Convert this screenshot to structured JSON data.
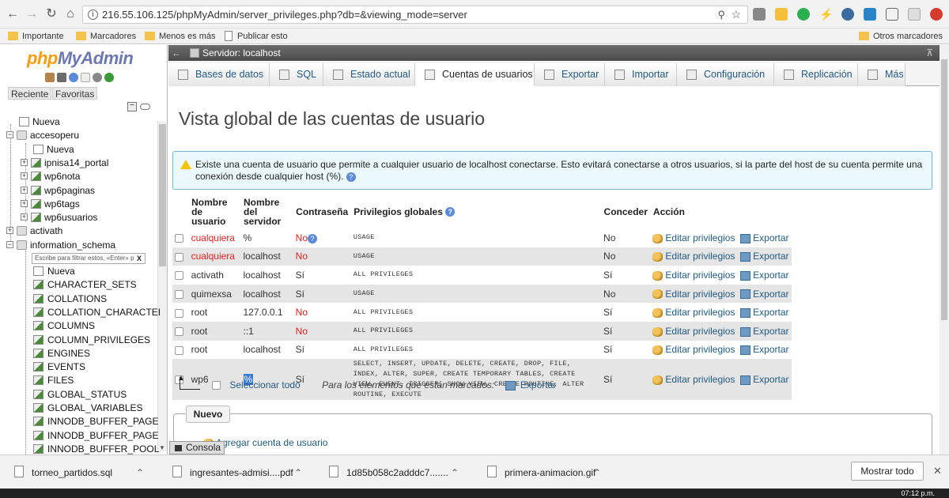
{
  "browser": {
    "url": "216.55.106.125/phpMyAdmin/server_privileges.php?db=&viewing_mode=server",
    "bookmarks": [
      "Importante",
      "Marcadores",
      "Menos es más",
      "Publicar esto"
    ],
    "other_bookmarks": "Otros marcadores"
  },
  "sidebar": {
    "logo_php": "php",
    "logo_myadmin": "MyAdmin",
    "tabs": [
      "Reciente",
      "Favoritas"
    ],
    "filter_placeholder": "Escribe para filtrar estos, «Enter» p",
    "filter_clear": "X",
    "tree": [
      {
        "label": "Nueva",
        "level": 0,
        "type": "new"
      },
      {
        "label": "accesoperu",
        "level": 0,
        "type": "db",
        "expander": "−"
      },
      {
        "label": "Nueva",
        "level": 1,
        "type": "new"
      },
      {
        "label": "ipnisa14_portal",
        "level": 1,
        "type": "table",
        "expander": "+"
      },
      {
        "label": "wp6nota",
        "level": 1,
        "type": "table",
        "expander": "+"
      },
      {
        "label": "wp6paginas",
        "level": 1,
        "type": "table",
        "expander": "+"
      },
      {
        "label": "wp6tags",
        "level": 1,
        "type": "table",
        "expander": "+"
      },
      {
        "label": "wp6usuarios",
        "level": 1,
        "type": "table",
        "expander": "+"
      },
      {
        "label": "activath",
        "level": 0,
        "type": "db",
        "expander": "+"
      },
      {
        "label": "information_schema",
        "level": 0,
        "type": "db",
        "expander": "−"
      }
    ],
    "schema_tables": [
      {
        "label": "Nueva",
        "type": "new"
      },
      {
        "label": "CHARACTER_SETS",
        "type": "table"
      },
      {
        "label": "COLLATIONS",
        "type": "table"
      },
      {
        "label": "COLLATION_CHARACTEI",
        "type": "table"
      },
      {
        "label": "COLUMNS",
        "type": "table"
      },
      {
        "label": "COLUMN_PRIVILEGES",
        "type": "table"
      },
      {
        "label": "ENGINES",
        "type": "table"
      },
      {
        "label": "EVENTS",
        "type": "table"
      },
      {
        "label": "FILES",
        "type": "table"
      },
      {
        "label": "GLOBAL_STATUS",
        "type": "table"
      },
      {
        "label": "GLOBAL_VARIABLES",
        "type": "table"
      },
      {
        "label": "INNODB_BUFFER_PAGE",
        "type": "table"
      },
      {
        "label": "INNODB_BUFFER_PAGE",
        "type": "table"
      },
      {
        "label": "INNODB_BUFFER_POOL",
        "type": "table"
      }
    ]
  },
  "server_bar": {
    "label": "Servidor: localhost"
  },
  "tabs": [
    {
      "label": "Bases de datos",
      "active": false
    },
    {
      "label": "SQL",
      "active": false
    },
    {
      "label": "Estado actual",
      "active": false
    },
    {
      "label": "Cuentas de usuarios",
      "active": true
    },
    {
      "label": "Exportar",
      "active": false
    },
    {
      "label": "Importar",
      "active": false
    },
    {
      "label": "Configuración",
      "active": false
    },
    {
      "label": "Replicación",
      "active": false
    },
    {
      "label": "Más",
      "active": false
    }
  ],
  "page_title": "Vista global de las cuentas de usuario",
  "notice": "Existe una cuenta de usuario que permite a cualquier usuario de localhost conectarse. Esto evitará conectarse a otros usuarios, si la parte del host de su cuenta permite una conexión desde cualquier host (%).",
  "table": {
    "headers": {
      "user": "Nombre de usuario",
      "host": "Nombre del servidor",
      "password": "Contraseña",
      "privileges": "Privilegios globales",
      "grant": "Conceder",
      "action": "Acción"
    },
    "edit_label": "Editar privilegios",
    "export_label": "Exportar",
    "rows": [
      {
        "user": "cualquiera",
        "user_red": true,
        "host": "%",
        "password": "No",
        "password_red": true,
        "password_help": true,
        "privileges": "USAGE",
        "grant": "No"
      },
      {
        "user": "cualquiera",
        "user_red": true,
        "host": "localhost",
        "password": "No",
        "password_red": true,
        "privileges": "USAGE",
        "grant": "No"
      },
      {
        "user": "activath",
        "host": "localhost",
        "password": "Sí",
        "privileges": "ALL PRIVILEGES",
        "grant": "Sí"
      },
      {
        "user": "quimexsa",
        "host": "localhost",
        "password": "Sí",
        "privileges": "USAGE",
        "grant": "No"
      },
      {
        "user": "root",
        "host": "127.0.0.1",
        "password": "No",
        "password_red": true,
        "privileges": "ALL PRIVILEGES",
        "grant": "Sí"
      },
      {
        "user": "root",
        "host": "::1",
        "password": "No",
        "password_red": true,
        "privileges": "ALL PRIVILEGES",
        "grant": "Sí"
      },
      {
        "user": "root",
        "host": "localhost",
        "password": "Sí",
        "privileges": "ALL PRIVILEGES",
        "grant": "Sí"
      },
      {
        "user": "wp6",
        "host": "%",
        "host_selected": true,
        "password": "Sí",
        "privileges": "SELECT, INSERT, UPDATE, DELETE, CREATE, DROP, FILE, INDEX, ALTER, SUPER, CREATE TEMPORARY TABLES, CREATE VIEW, EVENT, TRIGGER, SHOW VIEW, CREATE ROUTINE, ALTER ROUTINE, EXECUTE",
        "grant": "Sí"
      }
    ]
  },
  "bulk": {
    "select_all": "Seleccionar todo",
    "for_marked": "Para los elementos que están marcados:",
    "export": "Exportar"
  },
  "new_section": {
    "legend": "Nuevo",
    "add_user": "Agregar cuenta de usuario"
  },
  "console": "Consola",
  "downloads": {
    "items": [
      "torneo_partidos.sql",
      "ingresantes-admisi....pdf",
      "1d85b058c2adddc7.......",
      "primera-animacion.gif"
    ],
    "show_all": "Mostrar todo"
  },
  "clock": "07:12 p.m."
}
